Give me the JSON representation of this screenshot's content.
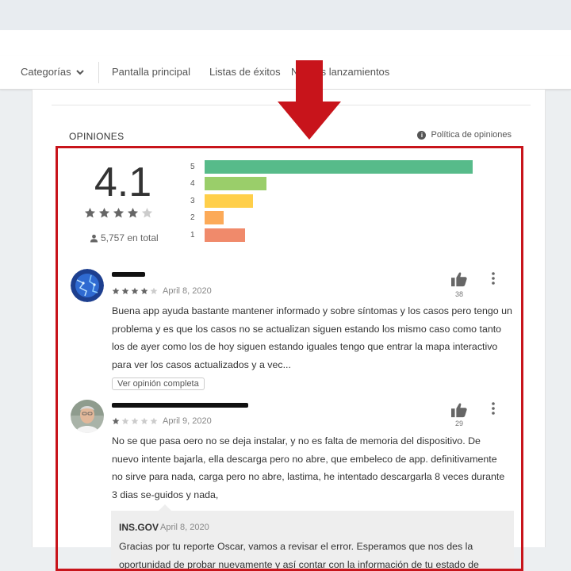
{
  "nav": {
    "categories_label": "Categorías",
    "links": [
      "Pantalla principal",
      "Listas de éxitos",
      "Nuevos lanzamientos"
    ]
  },
  "reviews_section": {
    "title": "OPINIONES",
    "policy_label": "Política de opiniones"
  },
  "summary": {
    "average": "4.1",
    "star_rating": 4,
    "total_label": "5,757 en total",
    "distribution": [
      {
        "stars": "5",
        "fraction": 1.0,
        "color": "#57bb8a"
      },
      {
        "stars": "4",
        "fraction": 0.23,
        "color": "#9ace6a"
      },
      {
        "stars": "3",
        "fraction": 0.18,
        "color": "#ffcf4a"
      },
      {
        "stars": "2",
        "fraction": 0.07,
        "color": "#fcaa58"
      },
      {
        "stars": "1",
        "fraction": 0.15,
        "color": "#f08a6b"
      }
    ]
  },
  "reviews": [
    {
      "stars": 4,
      "date": "April 8, 2020",
      "likes": "38",
      "text": "Buena app ayuda bastante mantener informado y sobre síntomas y los casos pero tengo un problema y es que los casos no se actualizan siguen estando los mismo caso como tanto los de ayer como los de hoy siguen estando iguales tengo que entrar la mapa interactivo para ver los casos actualizados y a vec...",
      "full_review_label": "Ver opinión completa"
    },
    {
      "stars": 1,
      "date": "April 9, 2020",
      "likes": "29",
      "text": "No se que pasa oero no se deja instalar, y no es falta de memoria del dispositivo. De nuevo intente bajarla, ella descarga pero no abre, que embeleco de app. definitivamente no sirve para nada, carga pero no abre, lastima, he intentado descargarla 8 veces durante 3 dias se-guidos y nada,",
      "reply": {
        "developer": "INS.GOV",
        "date": "April 8, 2020",
        "text": "Gracias por tu reporte Oscar, vamos a revisar el error. Esperamos que nos des la oportunidad de probar nuevamente y así contar con la información de tu estado de"
      }
    }
  ],
  "colors": {
    "highlight_border": "#c8141b",
    "arrow": "#c8141b",
    "star_filled": "#666666",
    "star_empty": "#cccccc"
  }
}
